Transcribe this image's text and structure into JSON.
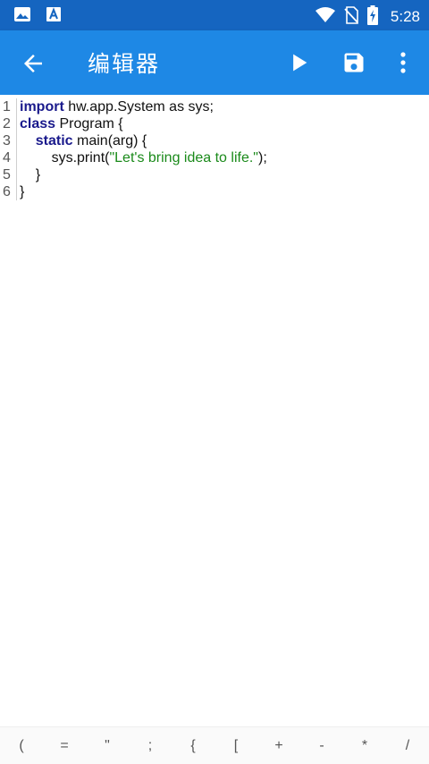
{
  "status_bar": {
    "time": "5:28",
    "icons": [
      "image-icon",
      "font-icon",
      "wifi-icon",
      "no-sim-icon",
      "battery-charging-icon"
    ]
  },
  "app_bar": {
    "title": "编辑器",
    "back_icon": "arrow-back-icon",
    "actions": [
      "play-icon",
      "save-icon",
      "more-vert-icon"
    ]
  },
  "editor": {
    "line_numbers": [
      "1",
      "2",
      "3",
      "4",
      "5",
      "6"
    ],
    "lines": [
      [
        {
          "t": "import",
          "k": "kw"
        },
        {
          "t": " hw.app.System as sys;",
          "k": ""
        }
      ],
      [
        {
          "t": "class",
          "k": "kw"
        },
        {
          "t": " Program {",
          "k": ""
        }
      ],
      [
        {
          "t": "    ",
          "k": ""
        },
        {
          "t": "static",
          "k": "kw"
        },
        {
          "t": " main(arg) {",
          "k": ""
        }
      ],
      [
        {
          "t": "        sys.print(",
          "k": ""
        },
        {
          "t": "\"Let's bring idea to life.\"",
          "k": "str"
        },
        {
          "t": ");",
          "k": ""
        }
      ],
      [
        {
          "t": "    }",
          "k": ""
        }
      ],
      [
        {
          "t": "}",
          "k": ""
        }
      ]
    ]
  },
  "key_bar": {
    "keys": [
      "(",
      "=",
      "\"",
      ";",
      "{",
      "[",
      "+",
      "-",
      "*",
      "/"
    ]
  },
  "colors": {
    "status_bar": "#1565c0",
    "app_bar": "#1e88e5",
    "keyword": "#1a1a8c",
    "string": "#1a8a1a"
  }
}
